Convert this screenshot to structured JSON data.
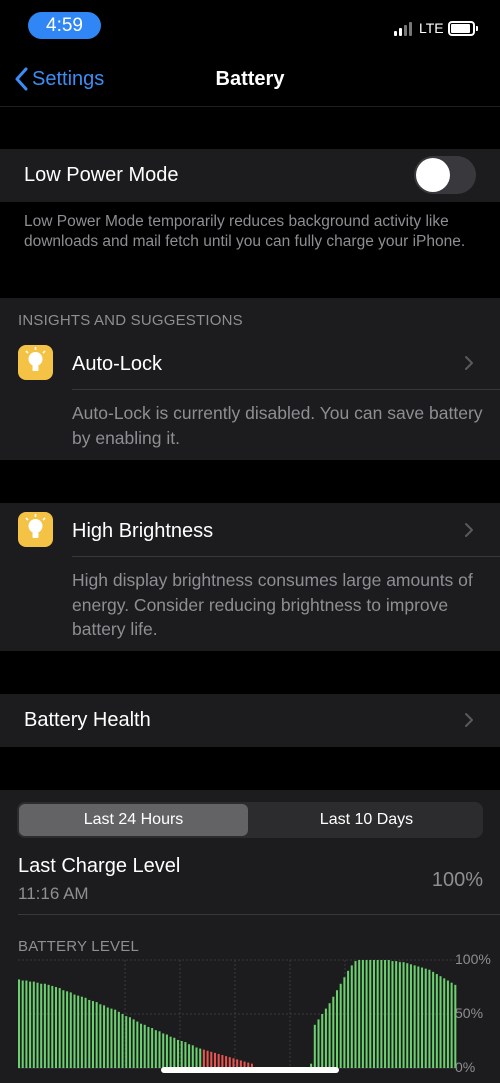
{
  "status_bar": {
    "time": "4:59",
    "network": "LTE"
  },
  "nav": {
    "back_label": "Settings",
    "title": "Battery"
  },
  "low_power": {
    "label": "Low Power Mode",
    "enabled": false,
    "footer": "Low Power Mode temporarily reduces background activity like downloads and mail fetch until you can fully charge your iPhone."
  },
  "insights": {
    "header": "INSIGHTS AND SUGGESTIONS",
    "items": [
      {
        "title": "Auto-Lock",
        "icon": "lightbulb-icon",
        "detail": "Auto-Lock is currently disabled. You can save battery by enabling it."
      },
      {
        "title": "High Brightness",
        "icon": "lightbulb-icon",
        "detail": "High display brightness consumes large amounts of energy. Consider reducing brightness to improve battery life."
      }
    ]
  },
  "battery_health": {
    "label": "Battery Health"
  },
  "usage": {
    "tabs": [
      "Last 24 Hours",
      "Last 10 Days"
    ],
    "active_tab": 0,
    "last_charge_label": "Last Charge Level",
    "last_charge_time": "11:16 AM",
    "last_charge_value": "100%",
    "chart_header": "BATTERY LEVEL"
  },
  "colors": {
    "accent": "#3b8ef5",
    "normal_bar": "#6ad16e",
    "low_bar": "#e8544e",
    "bulb": "#f4c245"
  },
  "chart_data": {
    "type": "bar",
    "title": "BATTERY LEVEL",
    "y_ticks": [
      "100%",
      "50%",
      "0%"
    ],
    "ylim": [
      0,
      100
    ],
    "grid": true,
    "segments": [
      {
        "state": "discharging",
        "values": [
          82,
          81,
          81,
          80,
          80,
          79,
          78,
          78,
          77,
          76,
          75,
          74,
          72,
          71,
          70,
          68,
          67,
          66,
          65,
          63,
          62,
          61,
          59,
          58,
          56,
          55,
          54,
          52,
          50,
          48,
          47,
          45,
          43,
          41,
          40,
          38,
          37,
          35,
          34,
          32,
          31,
          29,
          28,
          26,
          25,
          24,
          22,
          21,
          19,
          18
        ]
      },
      {
        "state": "low",
        "values": [
          17,
          16,
          15,
          14,
          13,
          12,
          11,
          10,
          9,
          8,
          7,
          6,
          5,
          4
        ]
      },
      {
        "state": "none",
        "count": 15
      },
      {
        "state": "charging",
        "values": [
          4,
          40,
          45,
          50,
          55,
          60,
          66,
          72,
          78,
          84,
          90,
          95,
          99,
          100,
          100,
          100,
          100,
          100,
          100,
          100,
          100,
          100,
          99,
          99,
          98,
          98,
          97,
          96,
          95,
          94,
          93,
          92,
          91,
          89,
          87,
          85,
          83,
          81,
          79,
          77
        ]
      }
    ]
  }
}
